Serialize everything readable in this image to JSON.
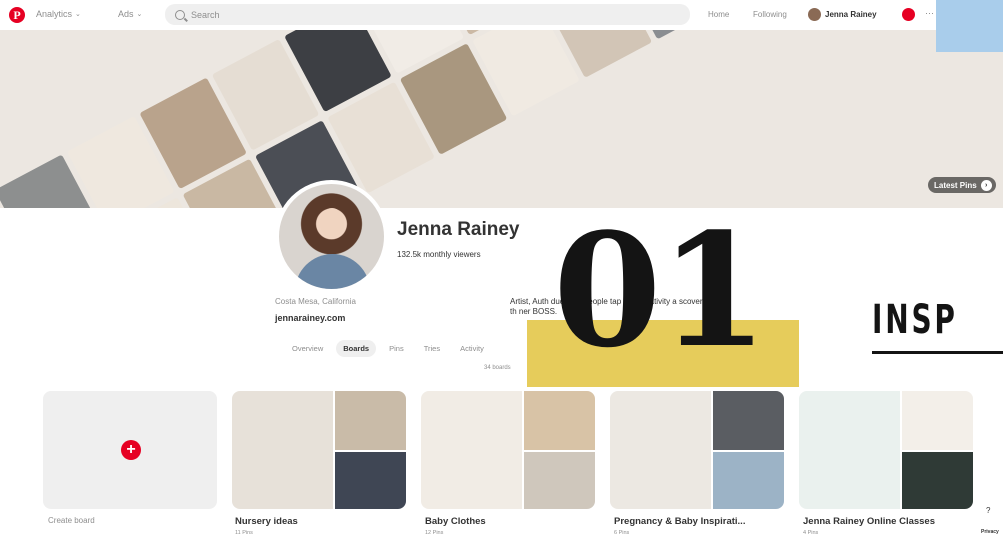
{
  "topbar": {
    "logo": "P",
    "analytics": "Analytics",
    "ads": "Ads",
    "search_placeholder": "Search",
    "home": "Home",
    "following": "Following",
    "username": "Jenna Rainey"
  },
  "cover": {
    "latest_pins": "Latest Pins",
    "tile_colors": [
      "#d8cfc4",
      "#8d8f8f",
      "#efe8df",
      "#b9a38c",
      "#e5ddd3",
      "#3d3f44",
      "#f1ece6",
      "#cbb9a5",
      "#a08466",
      "#e9e2d9",
      "#5e646b",
      "#d9d1c6",
      "#f4efe9",
      "#b8a898",
      "#e2d6c8",
      "#7c7467",
      "#ede6dc",
      "#c9b8a3",
      "#4b4e55",
      "#e8e0d6",
      "#a9977f",
      "#f0eae2",
      "#d2c5b6",
      "#8a8d91",
      "#e4dbcf",
      "#bfae98",
      "#f3eee8",
      "#6d6b66"
    ]
  },
  "profile": {
    "name": "Jenna Rainey",
    "viewers": "132.5k monthly viewers",
    "location": "Costa Mesa, California",
    "website": "jennarainey.com",
    "bio": "Artist, Auth     ducator i      people tap into creativity a       scover th      ner BOSS."
  },
  "tabs": [
    {
      "label": "Overview",
      "active": false
    },
    {
      "label": "Boards",
      "active": true
    },
    {
      "label": "Pins",
      "active": false
    },
    {
      "label": "Tries",
      "active": false
    },
    {
      "label": "Activity",
      "active": false
    }
  ],
  "boards_count": "34 boards",
  "overlay": {
    "number": "01",
    "heading": "INSP",
    "accent_color": "#e6cc5b"
  },
  "create_board": {
    "label": "Create board",
    "plus": "+"
  },
  "boards": [
    {
      "title": "Nursery ideas",
      "pins": "11 Pins",
      "colors": [
        "#e7e1d9",
        "#c9bba8",
        "#3f4654"
      ]
    },
    {
      "title": "Baby Clothes",
      "pins": "12 Pins",
      "colors": [
        "#f1ece5",
        "#d8c3a6",
        "#cfc7bc"
      ]
    },
    {
      "title": "Pregnancy & Baby Inspirati...",
      "pins": "6 Pins",
      "colors": [
        "#ece8e2",
        "#5a5d62",
        "#9cb3c6"
      ]
    },
    {
      "title": "Jenna Rainey Online Classes",
      "pins": "4 Pins",
      "colors": [
        "#eaf1ee",
        "#f3efe9",
        "#2f3a36"
      ]
    }
  ],
  "footer": {
    "help": "?",
    "privacy": "Privacy"
  }
}
